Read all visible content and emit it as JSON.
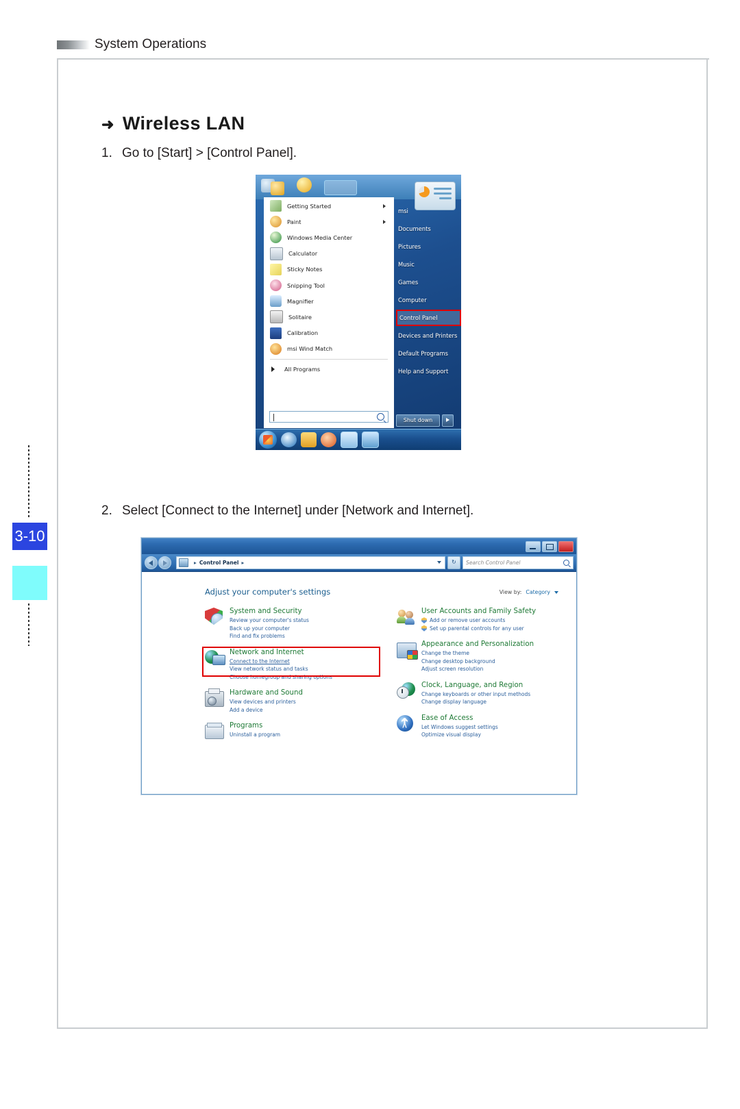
{
  "page": {
    "header_title": "System Operations",
    "page_number": "3-10"
  },
  "section": {
    "bullet": "➜",
    "title": "Wireless LAN",
    "steps": [
      {
        "num": "1.",
        "text": "Go to [Start] > [Control Panel]."
      },
      {
        "num": "2.",
        "text": "Select [Connect to the Internet] under [Network and Internet]."
      }
    ]
  },
  "start_menu": {
    "programs": [
      {
        "label": "Getting Started",
        "has_submenu": true,
        "icon": "getting-started-icon"
      },
      {
        "label": "Paint",
        "has_submenu": true,
        "icon": "paint-icon"
      },
      {
        "label": "Windows Media Center",
        "has_submenu": false,
        "icon": "windows-media-center-icon"
      },
      {
        "label": "Calculator",
        "has_submenu": false,
        "icon": "calculator-icon"
      },
      {
        "label": "Sticky Notes",
        "has_submenu": false,
        "icon": "sticky-notes-icon"
      },
      {
        "label": "Snipping Tool",
        "has_submenu": false,
        "icon": "snipping-tool-icon"
      },
      {
        "label": "Magnifier",
        "has_submenu": false,
        "icon": "magnifier-icon"
      },
      {
        "label": "Solitaire",
        "has_submenu": false,
        "icon": "solitaire-icon"
      },
      {
        "label": "Calibration",
        "has_submenu": false,
        "icon": "calibration-icon"
      },
      {
        "label": "msi Wind Match",
        "has_submenu": false,
        "icon": "msi-wind-match-icon"
      }
    ],
    "all_programs_label": "All Programs",
    "search_placeholder": "",
    "right_items": [
      {
        "label": "msi",
        "highlighted": false
      },
      {
        "label": "Documents",
        "highlighted": false
      },
      {
        "label": "Pictures",
        "highlighted": false
      },
      {
        "label": "Music",
        "highlighted": false
      },
      {
        "label": "Games",
        "highlighted": false
      },
      {
        "label": "Computer",
        "highlighted": false
      },
      {
        "label": "Control Panel",
        "highlighted": true
      },
      {
        "label": "Devices and Printers",
        "highlighted": false
      },
      {
        "label": "Default Programs",
        "highlighted": false
      },
      {
        "label": "Help and Support",
        "highlighted": false
      }
    ],
    "shutdown_label": "Shut down",
    "highlight_color": "#e00000"
  },
  "control_panel": {
    "address_crumb": "Control Panel",
    "search_placeholder": "Search Control Panel",
    "heading": "Adjust your computer's settings",
    "view_by_label": "View by:",
    "view_by_value": "Category",
    "highlight_color": "#e00000",
    "left_categories": [
      {
        "title": "System and Security",
        "icon": "security-shield-icon",
        "items": [
          {
            "text": "Review your computer's status",
            "underline": false,
            "shield": false
          },
          {
            "text": "Back up your computer",
            "underline": false,
            "shield": false
          },
          {
            "text": "Find and fix problems",
            "underline": false,
            "shield": false
          }
        ]
      },
      {
        "title": "Network and Internet",
        "icon": "network-globe-icon",
        "highlighted": true,
        "items": [
          {
            "text": "Connect to the Internet",
            "underline": true,
            "shield": false
          },
          {
            "text": "View network status and tasks",
            "underline": false,
            "shield": false
          },
          {
            "text": "Choose homegroup and sharing options",
            "underline": false,
            "shield": false
          }
        ]
      },
      {
        "title": "Hardware and Sound",
        "icon": "printer-icon",
        "items": [
          {
            "text": "View devices and printers",
            "underline": false,
            "shield": false
          },
          {
            "text": "Add a device",
            "underline": false,
            "shield": false
          }
        ]
      },
      {
        "title": "Programs",
        "icon": "programs-icon",
        "items": [
          {
            "text": "Uninstall a program",
            "underline": false,
            "shield": false
          }
        ]
      }
    ],
    "right_categories": [
      {
        "title": "User Accounts and Family Safety",
        "icon": "user-accounts-icon",
        "items": [
          {
            "text": "Add or remove user accounts",
            "underline": false,
            "shield": true
          },
          {
            "text": "Set up parental controls for any user",
            "underline": false,
            "shield": true
          }
        ]
      },
      {
        "title": "Appearance and Personalization",
        "icon": "appearance-icon",
        "items": [
          {
            "text": "Change the theme",
            "underline": false,
            "shield": false
          },
          {
            "text": "Change desktop background",
            "underline": false,
            "shield": false
          },
          {
            "text": "Adjust screen resolution",
            "underline": false,
            "shield": false
          }
        ]
      },
      {
        "title": "Clock, Language, and Region",
        "icon": "clock-language-icon",
        "items": [
          {
            "text": "Change keyboards or other input methods",
            "underline": false,
            "shield": false
          },
          {
            "text": "Change display language",
            "underline": false,
            "shield": false
          }
        ]
      },
      {
        "title": "Ease of Access",
        "icon": "ease-of-access-icon",
        "items": [
          {
            "text": "Let Windows suggest settings",
            "underline": false,
            "shield": false
          },
          {
            "text": "Optimize visual display",
            "underline": false,
            "shield": false
          }
        ]
      }
    ]
  }
}
